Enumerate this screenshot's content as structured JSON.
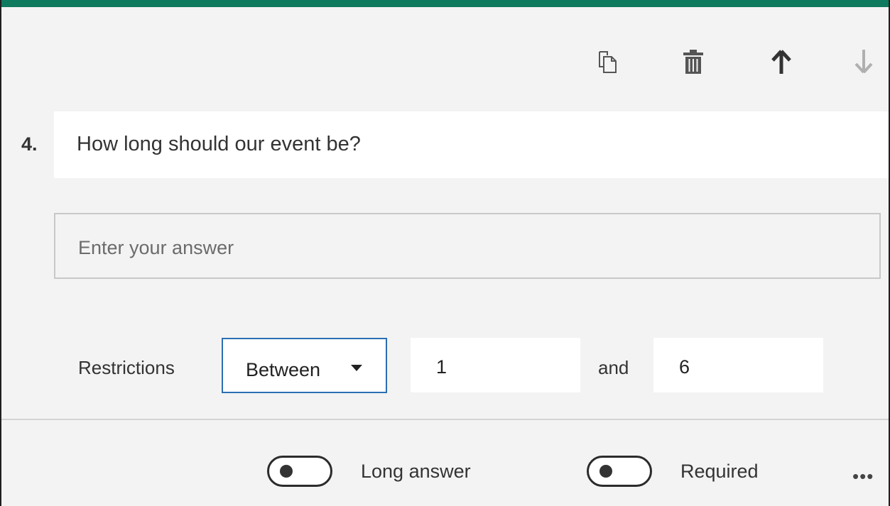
{
  "toolbar": {
    "icons": [
      "copy-icon",
      "trash-icon",
      "arrow-up-icon",
      "arrow-down-icon"
    ]
  },
  "question": {
    "number": "4.",
    "title": "How long should our event be?",
    "answer_placeholder": "Enter your answer"
  },
  "restrictions": {
    "label": "Restrictions",
    "type": "Between",
    "min": "1",
    "connector": "and",
    "max": "6"
  },
  "footer": {
    "long_answer_label": "Long answer",
    "long_answer_on": false,
    "required_label": "Required",
    "required_on": false,
    "more_label": "•••"
  },
  "colors": {
    "accent_bar": "#0e7a5e",
    "select_border": "#2a6fb3",
    "card_bg": "#f3f3f3"
  }
}
